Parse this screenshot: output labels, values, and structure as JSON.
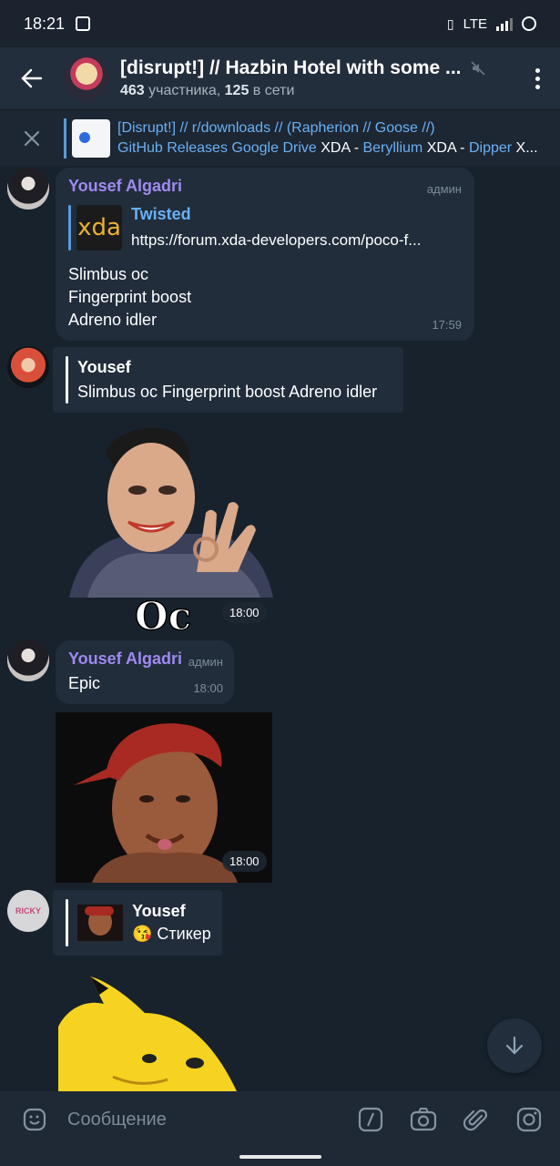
{
  "status_bar": {
    "time": "18:21",
    "network": "LTE"
  },
  "header": {
    "title": "[disrupt!] // Hazbin Hotel with some ...",
    "members_count": "463",
    "members_label": "участника,",
    "online_count": "125",
    "online_label": "в сети"
  },
  "pinned": {
    "line1": "[Disrupt!] // r/downloads // (Rapherion // Goose //)",
    "line2_parts": [
      "GitHub Releases",
      " Google Drive",
      " XDA",
      " - ",
      "Beryllium",
      " XDA",
      " - ",
      "Dipper",
      " X..."
    ]
  },
  "messages": [
    {
      "sender": "Yousef Algadri",
      "role": "админ",
      "link_title": "Twisted",
      "link_url": "https://forum.xda-developers.com/poco-f...",
      "link_thumb": "xda",
      "lines": [
        "Slimbus oc",
        "Fingerprint boost",
        "Adreno idler"
      ],
      "time": "17:59"
    },
    {
      "reply_name": "Yousef",
      "reply_text": "Slimbus oc Fingerprint boost Adreno idler"
    },
    {
      "sticker_caption": "Oc",
      "time": "18:00"
    },
    {
      "sender": "Yousef Algadri",
      "role": "админ",
      "text": "Epic",
      "time": "18:00"
    },
    {
      "photo_time": "18:00"
    },
    {
      "reply_name": "Yousef",
      "reply_text": "😘 Стикер",
      "ricky_label": "RICKY"
    }
  ],
  "input": {
    "placeholder": "Сообщение"
  },
  "colors": {
    "accent": "#6ab0f3",
    "sender": "#9f8af0",
    "bubble": "#212d3b",
    "bg": "#18222d"
  }
}
